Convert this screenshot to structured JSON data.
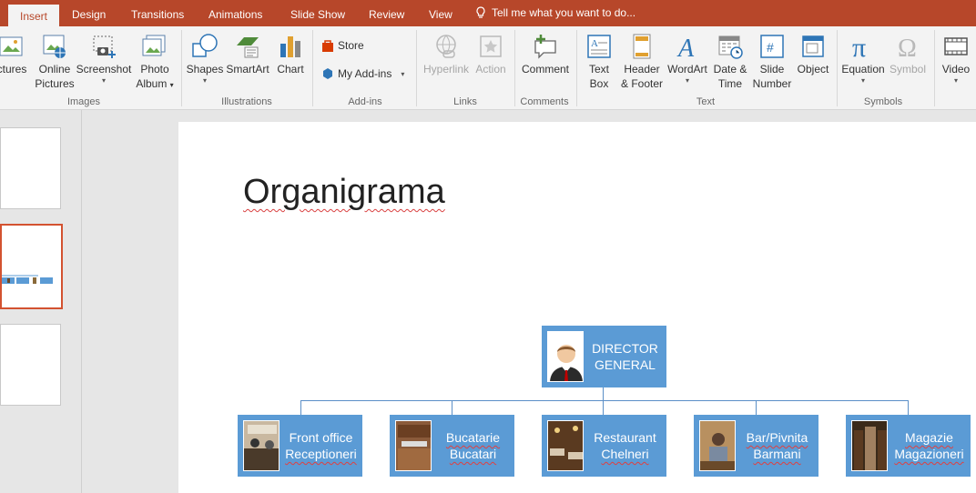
{
  "tabs": [
    {
      "label": "Insert",
      "active": true
    },
    {
      "label": "Design"
    },
    {
      "label": "Transitions"
    },
    {
      "label": "Animations"
    },
    {
      "label": "Slide Show"
    },
    {
      "label": "Review"
    },
    {
      "label": "View"
    }
  ],
  "tell_me": "Tell me what you want to do...",
  "ribbon": {
    "images": {
      "label": "Images",
      "pictures": "ctures",
      "online_pictures": [
        "Online",
        "Pictures"
      ],
      "screenshot": "Screenshot",
      "photo_album": [
        "Photo",
        "Album"
      ]
    },
    "illustrations": {
      "label": "Illustrations",
      "shapes": "Shapes",
      "smartart": "SmartArt",
      "chart": "Chart"
    },
    "addins": {
      "label": "Add-ins",
      "store": "Store",
      "my_addins": "My Add-ins"
    },
    "links": {
      "label": "Links",
      "hyperlink": "Hyperlink",
      "action": "Action"
    },
    "comments": {
      "label": "Comments",
      "comment": "Comment"
    },
    "text": {
      "label": "Text",
      "text_box": [
        "Text",
        "Box"
      ],
      "header_footer": [
        "Header",
        "& Footer"
      ],
      "wordart": "WordArt",
      "date_time": [
        "Date &",
        "Time"
      ],
      "slide_number": [
        "Slide",
        "Number"
      ],
      "object": "Object"
    },
    "symbols": {
      "label": "Symbols",
      "equation": "Equation",
      "symbol": "Symbol"
    },
    "media": {
      "video": "Video"
    }
  },
  "slide": {
    "title": "Organigrama",
    "director": [
      "DIRECTOR",
      "GENERAL"
    ],
    "departments": [
      {
        "line1": "Front  office",
        "line2": "Receptioneri"
      },
      {
        "line1": "Bucatarie",
        "line2": "Bucatari"
      },
      {
        "line1": "Restaurant",
        "line2": "Chelneri"
      },
      {
        "line1": "Bar/Pivnita",
        "line2": "Barmani"
      },
      {
        "line1": "Magazie",
        "line2": "Magazioneri"
      }
    ]
  },
  "colors": {
    "accent": "#b7472a",
    "org_box": "#5b9bd5",
    "selected_thumb": "#d35230"
  }
}
